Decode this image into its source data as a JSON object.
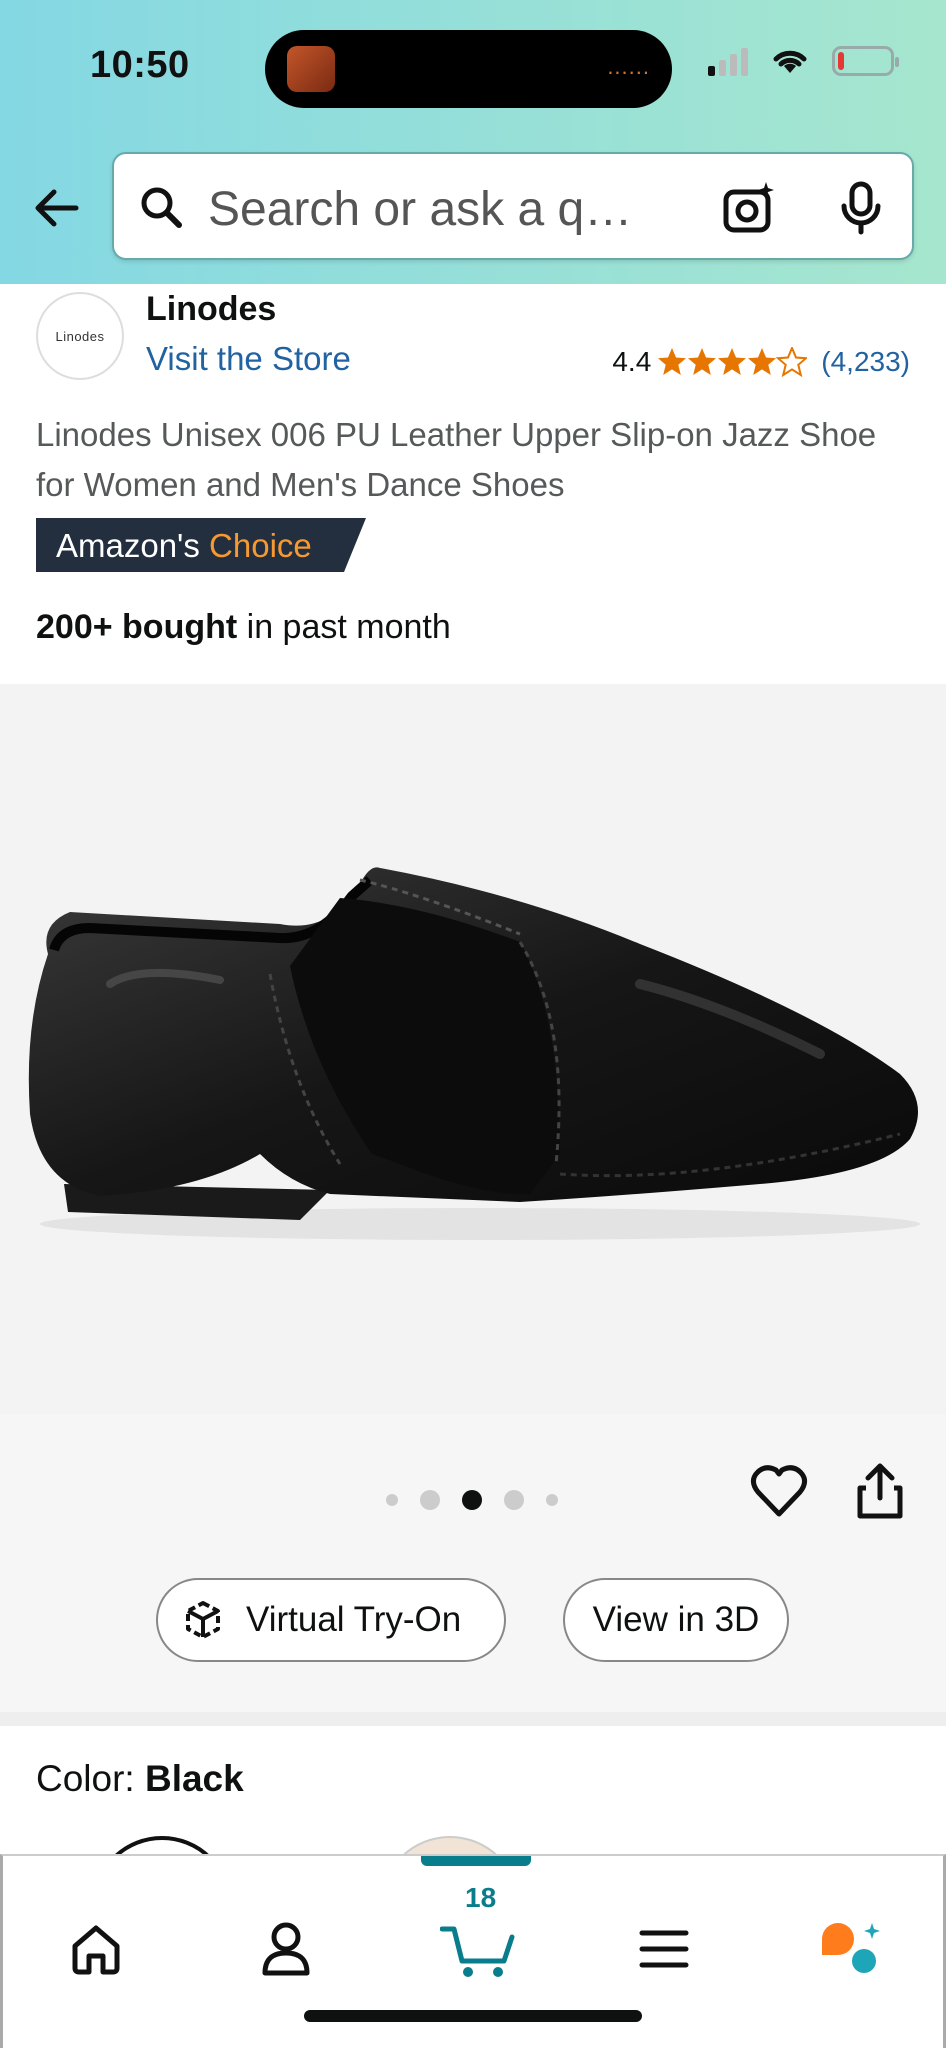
{
  "status_bar": {
    "time": "10:50",
    "island_dots": "......"
  },
  "header": {
    "search_placeholder": "Search or ask a q…",
    "icons": [
      "back-arrow-icon",
      "search-icon",
      "camera-icon",
      "microphone-icon"
    ]
  },
  "brand": {
    "logo_text": "Linodes",
    "name": "Linodes",
    "visit_store": "Visit the Store"
  },
  "rating": {
    "value": "4.4",
    "stars_out_of_5": 4.4,
    "count": "(4,233)",
    "star_color": "#e77600"
  },
  "product": {
    "title": "Linodes Unisex 006 PU Leather Upper Slip-on Jazz Shoe for Women and Men's Dance Shoes",
    "badge_part1": "Amazon's",
    "badge_part2": "Choice",
    "bought_bold": "200+ bought",
    "bought_rest": " in past month"
  },
  "gallery": {
    "total_images": 5,
    "active_index": 2,
    "try_on_label": "Virtual Try-On",
    "view_3d_label": "View in 3D"
  },
  "color_selector": {
    "label": "Color: ",
    "selected": "Black"
  },
  "tab_bar": {
    "items": [
      "home-icon",
      "account-icon",
      "cart-icon",
      "menu-icon",
      "rufus-icon"
    ],
    "cart_count": "18",
    "accent": "#0a7d8c"
  }
}
